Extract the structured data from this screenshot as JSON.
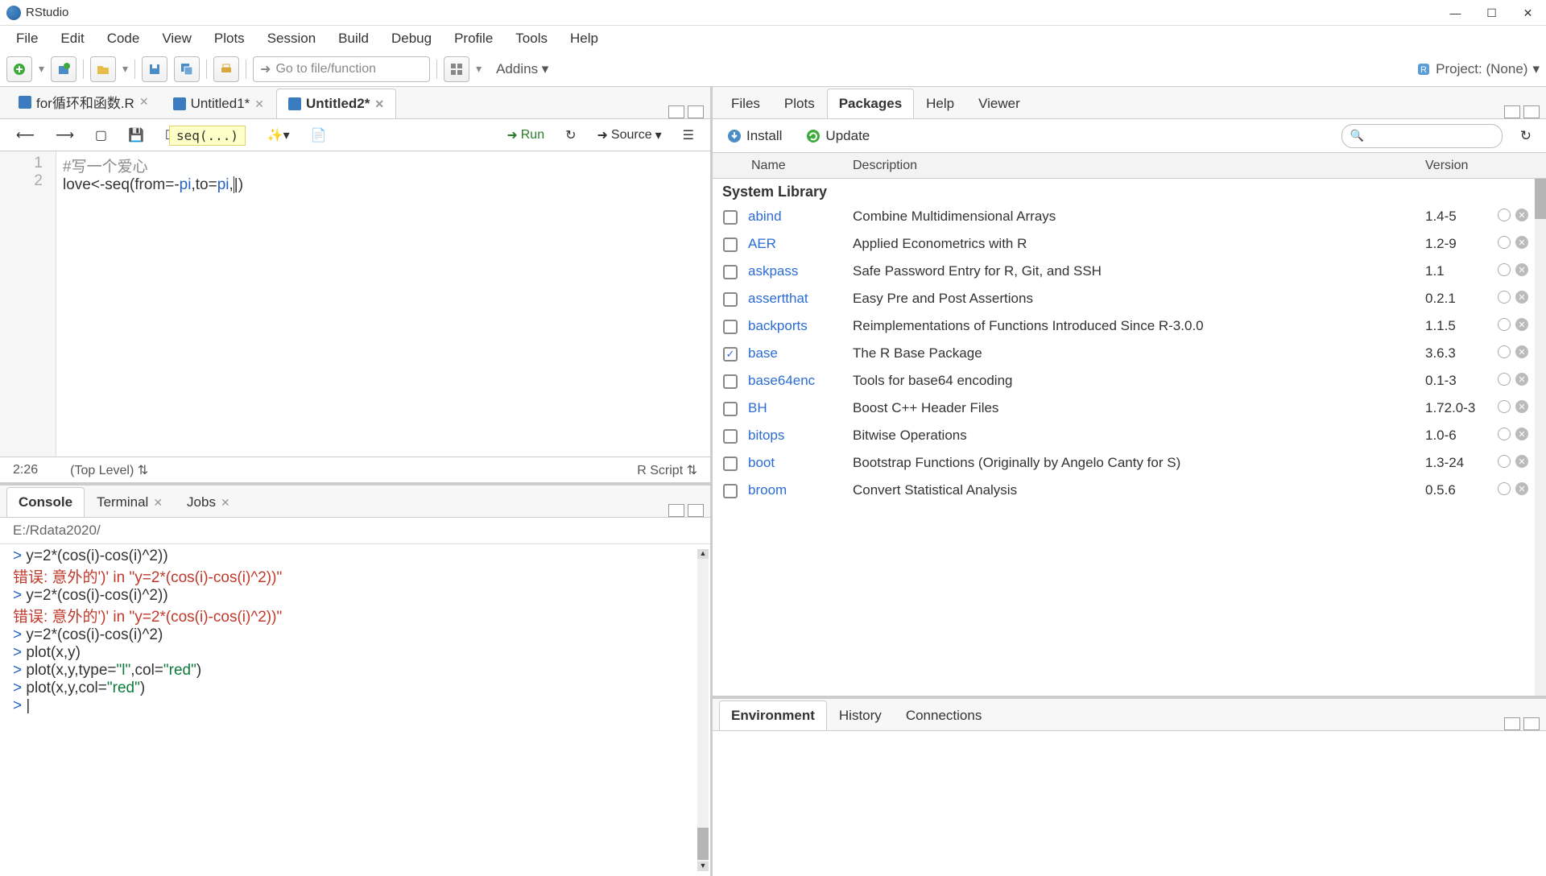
{
  "app": {
    "title": "RStudio"
  },
  "menubar": [
    "File",
    "Edit",
    "Code",
    "View",
    "Plots",
    "Session",
    "Build",
    "Debug",
    "Profile",
    "Tools",
    "Help"
  ],
  "toolbar": {
    "goto_placeholder": "Go to file/function",
    "addins": "Addins",
    "project": "Project: (None)"
  },
  "source": {
    "tabs": [
      {
        "label": "for循环和函数.R",
        "dirty": false
      },
      {
        "label": "Untitled1*",
        "dirty": true
      },
      {
        "label": "Untitled2*",
        "dirty": true
      }
    ],
    "active_tab": 2,
    "toolbar": {
      "save": "Save",
      "run": "Run",
      "source": "Source"
    },
    "hint": "seq(...)",
    "code": {
      "1": "#写一个爱心",
      "2": "love<-seq(from=-pi,to=pi,)"
    },
    "cursor_display": "2:26",
    "scope": "(Top Level)",
    "lang": "R Script"
  },
  "console": {
    "tabs": [
      "Console",
      "Terminal",
      "Jobs"
    ],
    "active_tab": 0,
    "path": "E:/Rdata2020/",
    "lines": [
      {
        "t": "in",
        "text": "y=2*(cos(i)-cos(i)^2))"
      },
      {
        "t": "err",
        "text": "错误: 意外的')' in \"y=2*(cos(i)-cos(i)^2))\""
      },
      {
        "t": "in",
        "text": "y=2*(cos(i)-cos(i)^2))"
      },
      {
        "t": "err",
        "text": "错误: 意外的')' in \"y=2*(cos(i)-cos(i)^2))\""
      },
      {
        "t": "in",
        "text": "y=2*(cos(i)-cos(i)^2)"
      },
      {
        "t": "in",
        "text": "plot(x,y)"
      },
      {
        "t": "in",
        "text": "plot(x,y,type=\"l\",col=\"red\")"
      },
      {
        "t": "in",
        "text": "plot(x,y,col=\"red\")"
      },
      {
        "t": "in",
        "text": ""
      }
    ]
  },
  "packages": {
    "tabs": [
      "Files",
      "Plots",
      "Packages",
      "Help",
      "Viewer"
    ],
    "active_tab": 2,
    "toolbar": {
      "install": "Install",
      "update": "Update"
    },
    "columns": {
      "name": "Name",
      "desc": "Description",
      "version": "Version"
    },
    "section": "System Library",
    "rows": [
      {
        "name": "abind",
        "desc": "Combine Multidimensional Arrays",
        "ver": "1.4-5",
        "checked": false
      },
      {
        "name": "AER",
        "desc": "Applied Econometrics with R",
        "ver": "1.2-9",
        "checked": false
      },
      {
        "name": "askpass",
        "desc": "Safe Password Entry for R, Git, and SSH",
        "ver": "1.1",
        "checked": false
      },
      {
        "name": "assertthat",
        "desc": "Easy Pre and Post Assertions",
        "ver": "0.2.1",
        "checked": false
      },
      {
        "name": "backports",
        "desc": "Reimplementations of Functions Introduced Since R-3.0.0",
        "ver": "1.1.5",
        "checked": false
      },
      {
        "name": "base",
        "desc": "The R Base Package",
        "ver": "3.6.3",
        "checked": true
      },
      {
        "name": "base64enc",
        "desc": "Tools for base64 encoding",
        "ver": "0.1-3",
        "checked": false
      },
      {
        "name": "BH",
        "desc": "Boost C++ Header Files",
        "ver": "1.72.0-3",
        "checked": false
      },
      {
        "name": "bitops",
        "desc": "Bitwise Operations",
        "ver": "1.0-6",
        "checked": false
      },
      {
        "name": "boot",
        "desc": "Bootstrap Functions (Originally by Angelo Canty for S)",
        "ver": "1.3-24",
        "checked": false
      },
      {
        "name": "broom",
        "desc": "Convert Statistical Analysis",
        "ver": "0.5.6",
        "checked": false
      }
    ]
  },
  "bottom_right": {
    "tabs": [
      "Environment",
      "History",
      "Connections"
    ],
    "active_tab": 0
  }
}
